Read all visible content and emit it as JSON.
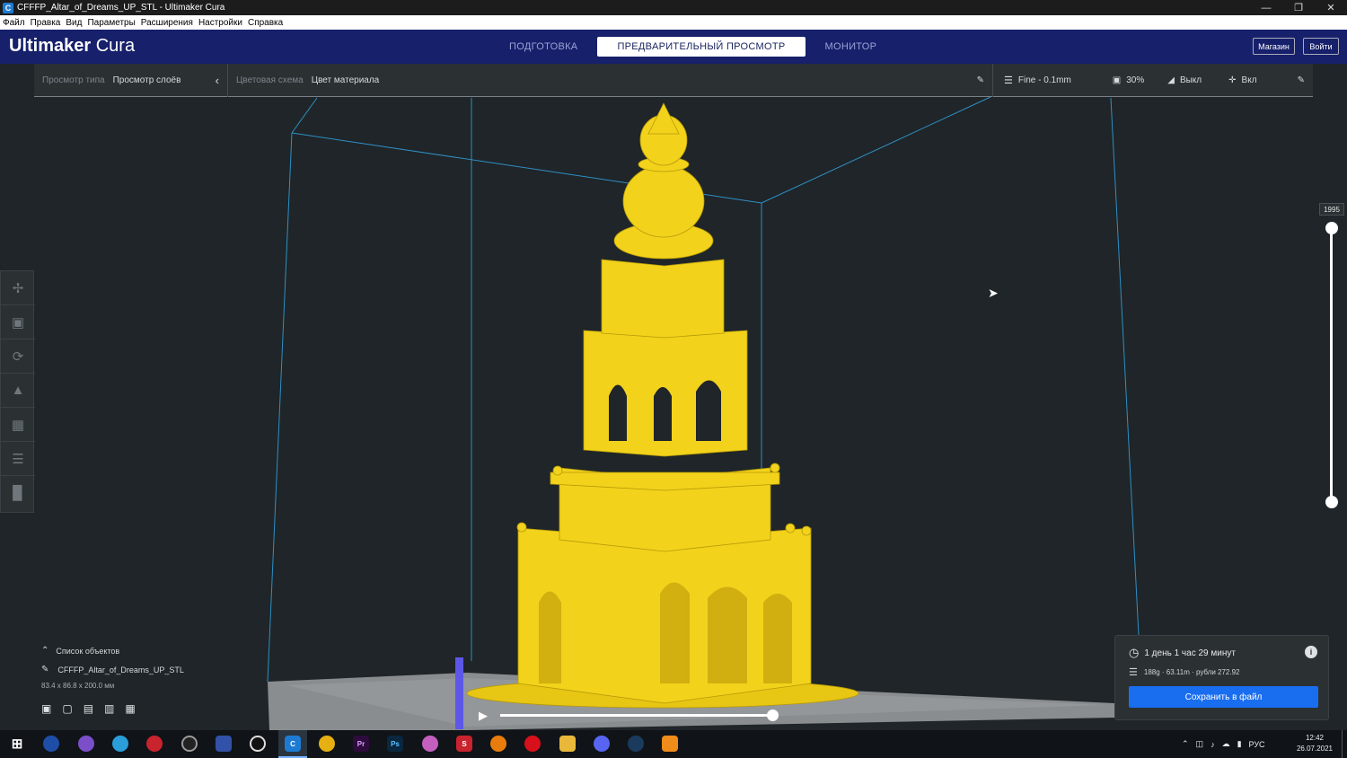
{
  "window": {
    "title": "CFFFP_Altar_of_Dreams_UP_STL - Ultimaker Cura",
    "app_icon": "C",
    "controls": [
      "minimize-icon",
      "restore-icon",
      "close-icon"
    ]
  },
  "menu": [
    "Файл",
    "Правка",
    "Вид",
    "Параметры",
    "Расширения",
    "Настройки",
    "Справка"
  ],
  "header": {
    "logo_bold": "Ultimaker",
    "logo_light": " Cura",
    "stages": [
      "ПОДГОТОВКА",
      "ПРЕДВАРИТЕЛЬНЫЙ ПРОСМОТР",
      "МОНИТОР"
    ],
    "active_stage": "ПРЕДВАРИТЕЛЬНЫЙ ПРОСМОТР",
    "marketplace_label": "Магазин",
    "signin_label": "Войти"
  },
  "viewbar": {
    "view_type_label": "Просмотр типа",
    "view_type_value": "Просмотр слоёв",
    "color_scheme_label": "Цветовая схема",
    "color_scheme_value": "Цвет материала",
    "profile": "Fine - 0.1mm",
    "infill": "30%",
    "support": "Выкл",
    "adhesion": "Вкл"
  },
  "layer_slider": {
    "top_value": "1995"
  },
  "object_list": {
    "title": "Список объектов",
    "file_name": "CFFFP_Altar_of_Dreams_UP_STL",
    "dimensions": "83.4 x 86.8 x 200.0 мм"
  },
  "print_info": {
    "time": "1 день 1 час 29 минут",
    "material": "188g · 63.11m · рубли 272.92",
    "save_label": "Сохранить в файл"
  },
  "taskbar": {
    "time": "12:42",
    "date": "26.07.2021",
    "lang": "РУС"
  },
  "colors": {
    "header": "#17206b",
    "viewport": "#1f2528",
    "model": "#f2d21b",
    "accent": "#196ef0"
  }
}
